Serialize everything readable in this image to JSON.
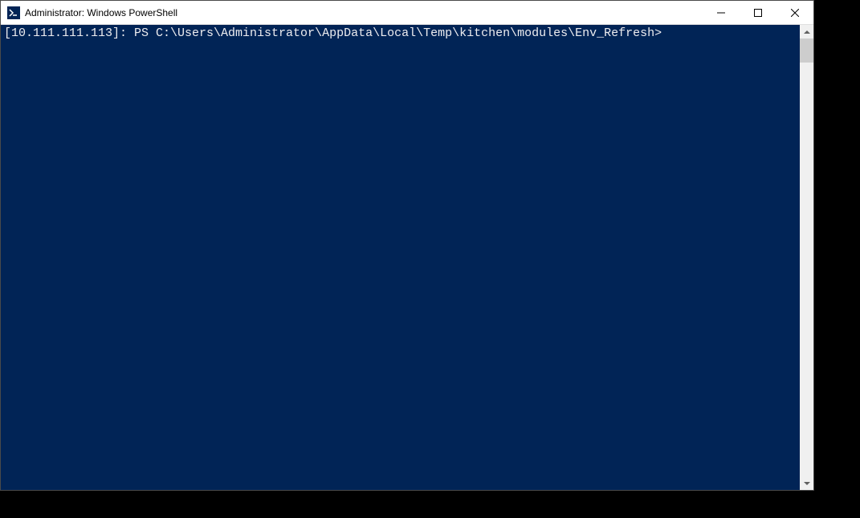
{
  "window": {
    "title": "Administrator: Windows PowerShell"
  },
  "terminal": {
    "prompt": "[10.111.111.113]: PS C:\\Users\\Administrator\\AppData\\Local\\Temp\\kitchen\\modules\\Env_Refresh>",
    "input": ""
  },
  "colors": {
    "terminal_bg": "#012456",
    "terminal_fg": "#eeedf0"
  }
}
